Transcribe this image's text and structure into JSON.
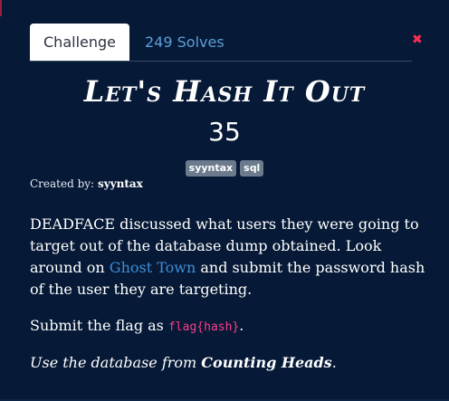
{
  "tabs": {
    "challenge": "Challenge",
    "solves": "249 Solves"
  },
  "icons": {
    "close": "close-icon"
  },
  "colors": {
    "background": "#061936",
    "link": "#3f8fd8",
    "code": "#ff3d8b",
    "close": "#ff2d55"
  },
  "challenge": {
    "title": "Let's Hash It Out",
    "points": "35",
    "tags": [
      "syyntax",
      "sql"
    ],
    "created_by_label": "Created by:",
    "author": "syyntax",
    "desc_part1": "DEADFACE discussed what users they were going to target out of the database dump obtained. Look around on ",
    "desc_link": "Ghost Town",
    "desc_part2": " and submit the password hash of the user they are targeting.",
    "flag_prefix": "Submit the flag as ",
    "flag_format": "flag{hash}",
    "flag_suffix": ".",
    "db_prefix": "Use the database from ",
    "db_name": "Counting Heads",
    "db_suffix": "."
  }
}
